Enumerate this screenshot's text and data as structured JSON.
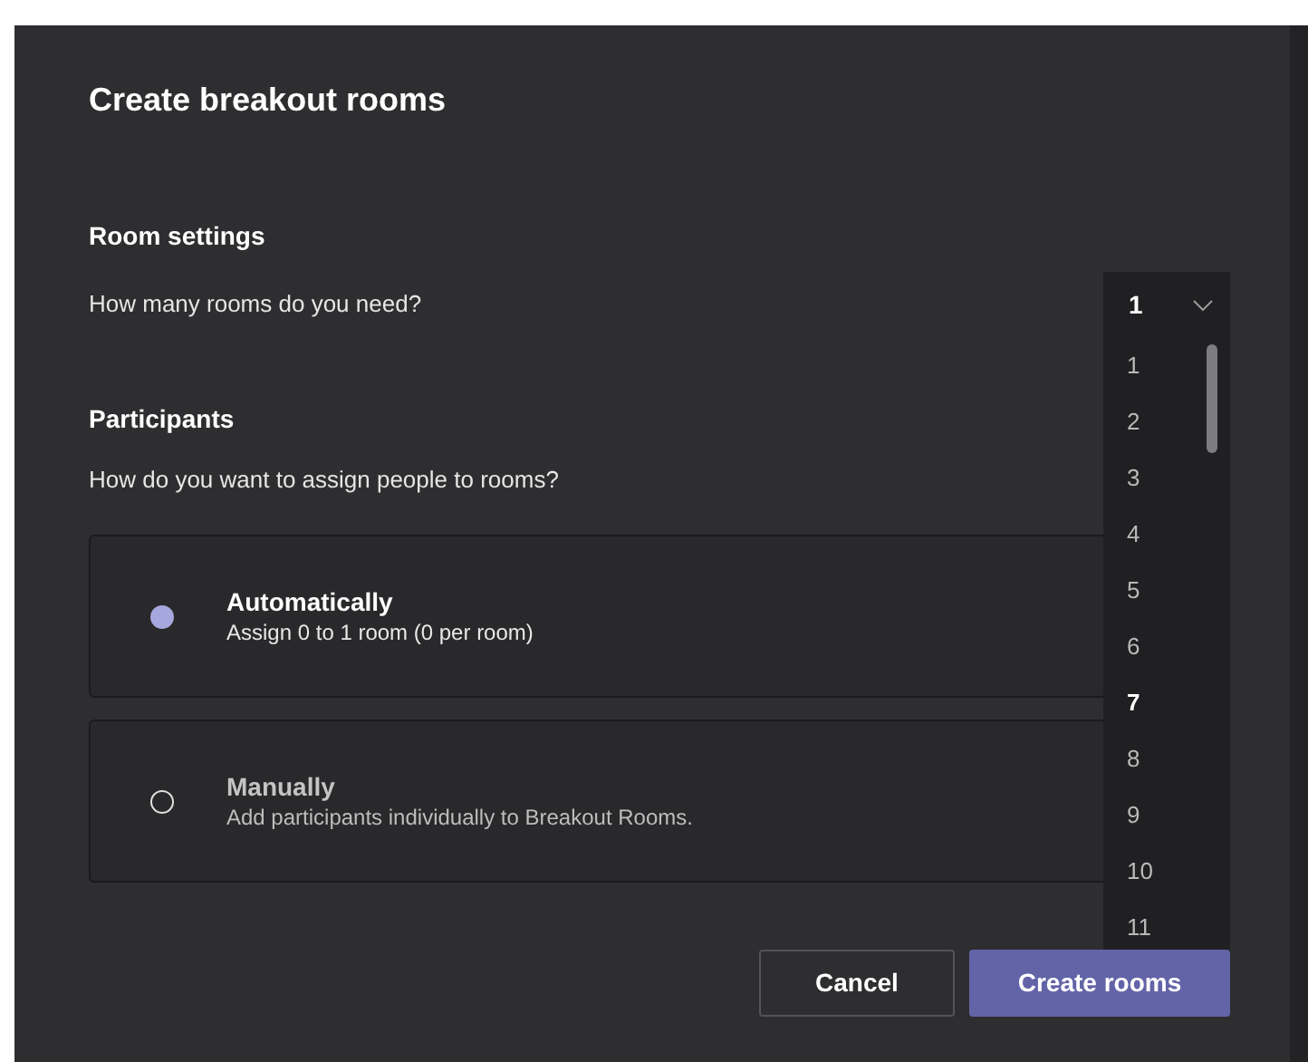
{
  "dialog": {
    "title": "Create breakout rooms"
  },
  "room_settings": {
    "heading": "Room settings",
    "question": "How many rooms do you need?",
    "dropdown": {
      "value": "1",
      "expanded": true,
      "options": [
        {
          "label": "1",
          "hovered": false
        },
        {
          "label": "2",
          "hovered": false
        },
        {
          "label": "3",
          "hovered": false
        },
        {
          "label": "4",
          "hovered": false
        },
        {
          "label": "5",
          "hovered": false
        },
        {
          "label": "6",
          "hovered": false
        },
        {
          "label": "7",
          "hovered": true
        },
        {
          "label": "8",
          "hovered": false
        },
        {
          "label": "9",
          "hovered": false
        },
        {
          "label": "10",
          "hovered": false
        },
        {
          "label": "11",
          "hovered": false
        }
      ]
    }
  },
  "participants": {
    "heading": "Participants",
    "question": "How do you want to assign people to rooms?",
    "options": [
      {
        "title": "Automatically",
        "description": "Assign 0 to 1 room (0 per room)",
        "selected": true
      },
      {
        "title": "Manually",
        "description": "Add participants individually to Breakout Rooms.",
        "selected": false
      }
    ]
  },
  "buttons": [
    {
      "label": "Cancel",
      "kind": "secondary"
    },
    {
      "label": "Create rooms",
      "kind": "primary"
    }
  ]
}
